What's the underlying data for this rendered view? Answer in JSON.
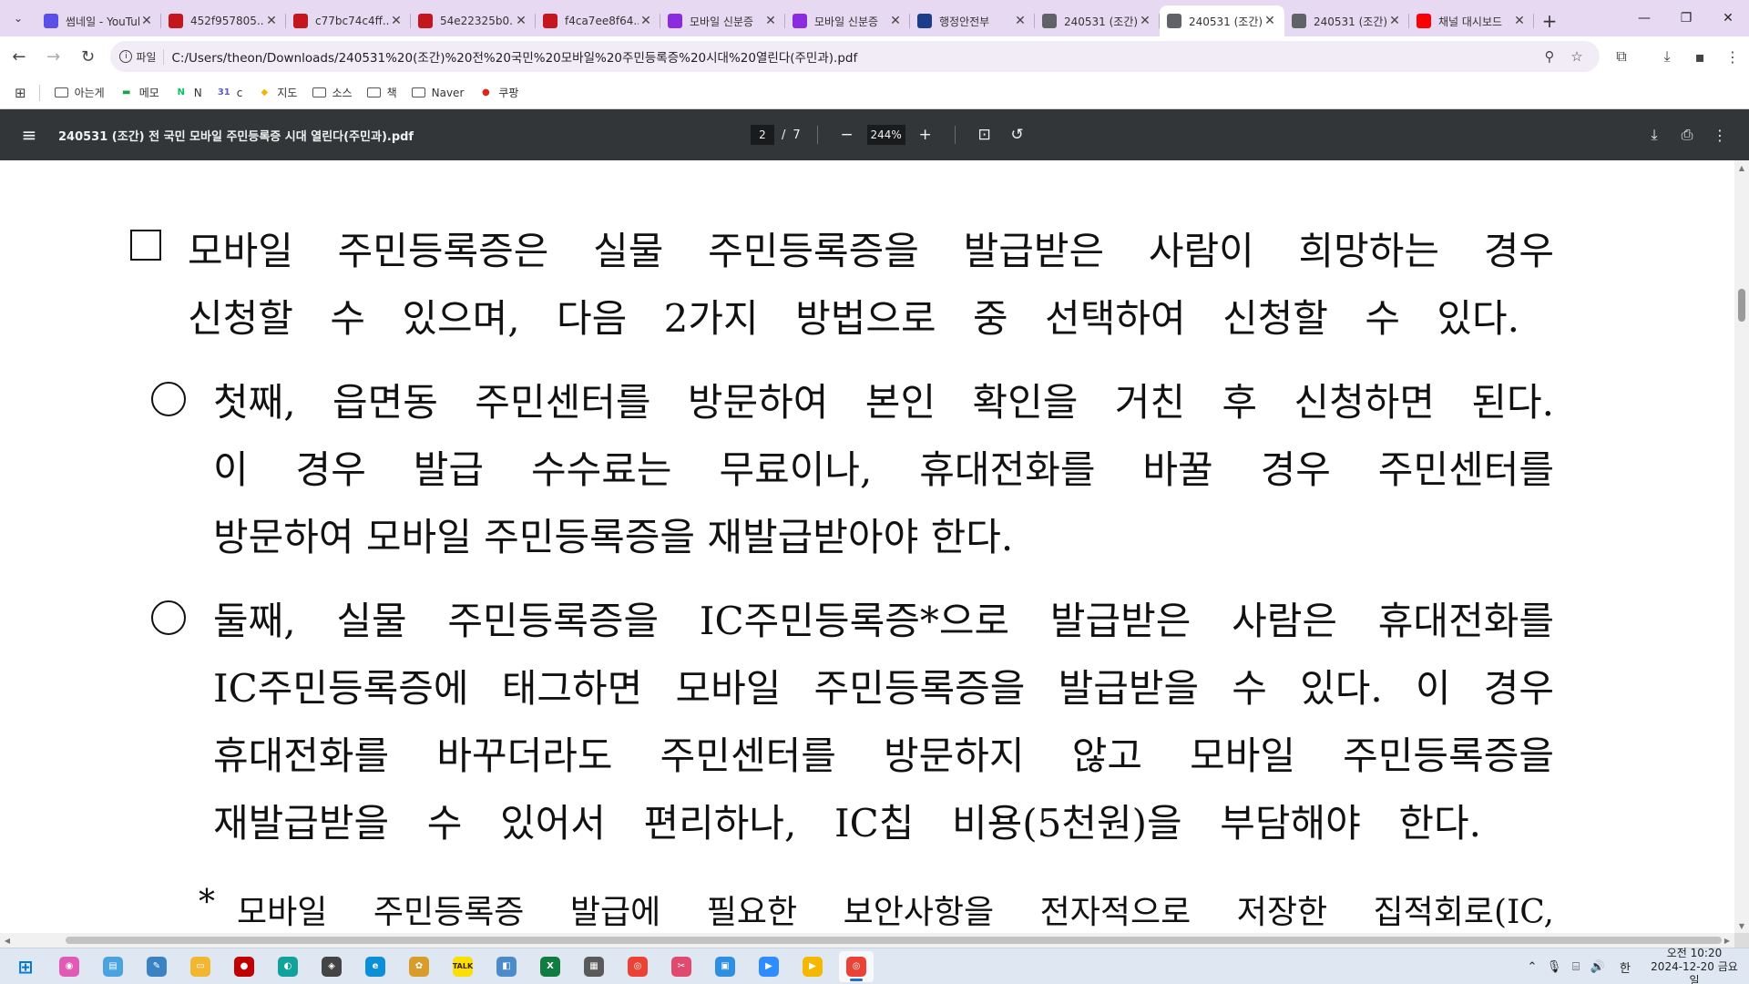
{
  "browser": {
    "tabs": [
      {
        "title": "썸네일 - YouTube",
        "favicon_color": "#5b4fe8",
        "favicon": "shield-icon",
        "active": false
      },
      {
        "title": "452f957805...",
        "favicon_color": "#c4161c",
        "favicon": "pdf-icon",
        "active": false
      },
      {
        "title": "c77bc74c4ff...",
        "favicon_color": "#c4161c",
        "favicon": "pdf-icon",
        "active": false
      },
      {
        "title": "54e22325b0...",
        "favicon_color": "#c4161c",
        "favicon": "pdf-icon",
        "active": false
      },
      {
        "title": "f4ca7ee8f64...",
        "favicon_color": "#c4161c",
        "favicon": "pdf-icon",
        "active": false
      },
      {
        "title": "모바일 신분증",
        "favicon_color": "#8a2be2",
        "favicon": "doc-icon",
        "active": false
      },
      {
        "title": "모바일 신분증",
        "favicon_color": "#8a2be2",
        "favicon": "doc-icon",
        "active": false
      },
      {
        "title": "행정안전부",
        "favicon_color": "#1a3e8c",
        "favicon": "gov-icon",
        "active": false
      },
      {
        "title": "240531 (조간)",
        "favicon_color": "#5f6368",
        "favicon": "globe-icon",
        "active": false
      },
      {
        "title": "240531 (조간)",
        "favicon_color": "#5f6368",
        "favicon": "globe-icon",
        "active": true
      },
      {
        "title": "240531 (조간)",
        "favicon_color": "#5f6368",
        "favicon": "globe-icon",
        "active": false
      },
      {
        "title": "채널 대시보드",
        "favicon_color": "#ff0000",
        "favicon": "youtube-icon",
        "active": false
      }
    ],
    "address": {
      "scheme_label": "파일",
      "url": "C:/Users/theon/Downloads/240531%20(조간)%20전%20국민%20모바일%20주민등록증%20시대%20열린다(주민과).pdf"
    },
    "bookmarks": [
      {
        "label": "아는게",
        "type": "folder"
      },
      {
        "label": "메모",
        "type": "site",
        "color": "#1aa34a",
        "glyph": "▬"
      },
      {
        "label": "N",
        "type": "site",
        "color": "#03c75a",
        "glyph": "N"
      },
      {
        "label": "c",
        "type": "site",
        "color": "#5b5fc7",
        "glyph": "31"
      },
      {
        "label": "지도",
        "type": "site",
        "color": "#f4b400",
        "glyph": "◆"
      },
      {
        "label": "소스",
        "type": "folder"
      },
      {
        "label": "책",
        "type": "folder"
      },
      {
        "label": "Naver",
        "type": "folder"
      },
      {
        "label": "쿠팡",
        "type": "site",
        "color": "#e2231a",
        "glyph": "●"
      }
    ]
  },
  "pdf": {
    "title": "240531 (조간) 전 국민 모바일 주민등록증 시대 열린다(주민과).pdf",
    "current_page": "2",
    "page_separator": "/",
    "total_pages": "7",
    "zoom": "244%"
  },
  "document": {
    "lines": [
      {
        "text": "모바일 주민등록증은 실물 주민등록증을 발급받은 사람이 희망하는 경우",
        "marker": "square"
      },
      {
        "text": "신청할 수 있으며, 다음 2가지 방법으로 중 선택하여 신청할 수 있다.",
        "marker": "none"
      },
      {
        "text": "첫째, 읍면동 주민센터를 방문하여 본인 확인을 거친 후 신청하면 된다.",
        "marker": "circle"
      },
      {
        "text": "이 경우 발급 수수료는 무료이나, 휴대전화를 바꿀 경우 주민센터를",
        "marker": "none"
      },
      {
        "text": "방문하여 모바일 주민등록증을 재발급받아야 한다.",
        "marker": "none"
      },
      {
        "text": "둘째, 실물 주민등록증을 IC주민등록증*으로 발급받은 사람은 휴대전화를",
        "marker": "circle"
      },
      {
        "text": "IC주민등록증에 태그하면 모바일 주민등록증을 발급받을 수 있다. 이 경우",
        "marker": "none"
      },
      {
        "text": "휴대전화를 바꾸더라도 주민센터를 방문하지 않고 모바일 주민등록증을",
        "marker": "none"
      },
      {
        "text": "재발급받을 수 있어서 편리하나, IC칩 비용(5천원)을 부담해야 한다.",
        "marker": "none"
      },
      {
        "text": "모바일 주민등록증 발급에 필요한 보안사항을 전자적으로 저장한 집적회로(IC,",
        "marker": "asterisk"
      }
    ],
    "asterisk": "*"
  },
  "taskbar": {
    "apps": [
      {
        "name": "windows-start",
        "color": "#0078d4",
        "glyph": "⊞"
      },
      {
        "name": "copilot",
        "color": "#e05bb5",
        "glyph": "◉"
      },
      {
        "name": "file-explorer-alt",
        "color": "#4aa3df",
        "glyph": "▤"
      },
      {
        "name": "notes",
        "color": "#3b82c4",
        "glyph": "✎"
      },
      {
        "name": "file-explorer",
        "color": "#f2b731",
        "glyph": "▭"
      },
      {
        "name": "recorder",
        "color": "#c00000",
        "glyph": "●"
      },
      {
        "name": "app-teal",
        "color": "#11a39b",
        "glyph": "◐"
      },
      {
        "name": "davinci",
        "color": "#444444",
        "glyph": "◈"
      },
      {
        "name": "edge",
        "color": "#0b8fd6",
        "glyph": "e"
      },
      {
        "name": "paint",
        "color": "#d89c2a",
        "glyph": "✿"
      },
      {
        "name": "kakaotalk",
        "color": "#f9e000",
        "glyph": "TALK"
      },
      {
        "name": "app-blue",
        "color": "#4c8bc9",
        "glyph": "◧"
      },
      {
        "name": "excel",
        "color": "#107c41",
        "glyph": "X"
      },
      {
        "name": "calculator",
        "color": "#5a5a5a",
        "glyph": "▦"
      },
      {
        "name": "chrome",
        "color": "#ea4335",
        "glyph": "◎"
      },
      {
        "name": "snipping",
        "color": "#e04a6e",
        "glyph": "✂"
      },
      {
        "name": "app-sky",
        "color": "#2e8fe0",
        "glyph": "▣"
      },
      {
        "name": "zoom",
        "color": "#2d8cff",
        "glyph": "▶"
      },
      {
        "name": "player",
        "color": "#f5b800",
        "glyph": "▶"
      },
      {
        "name": "chrome-active",
        "color": "#ea4335",
        "glyph": "◎",
        "active": true
      }
    ],
    "ime": "한",
    "time": "오전 10:20",
    "date": "2024-12-20 금요일"
  }
}
